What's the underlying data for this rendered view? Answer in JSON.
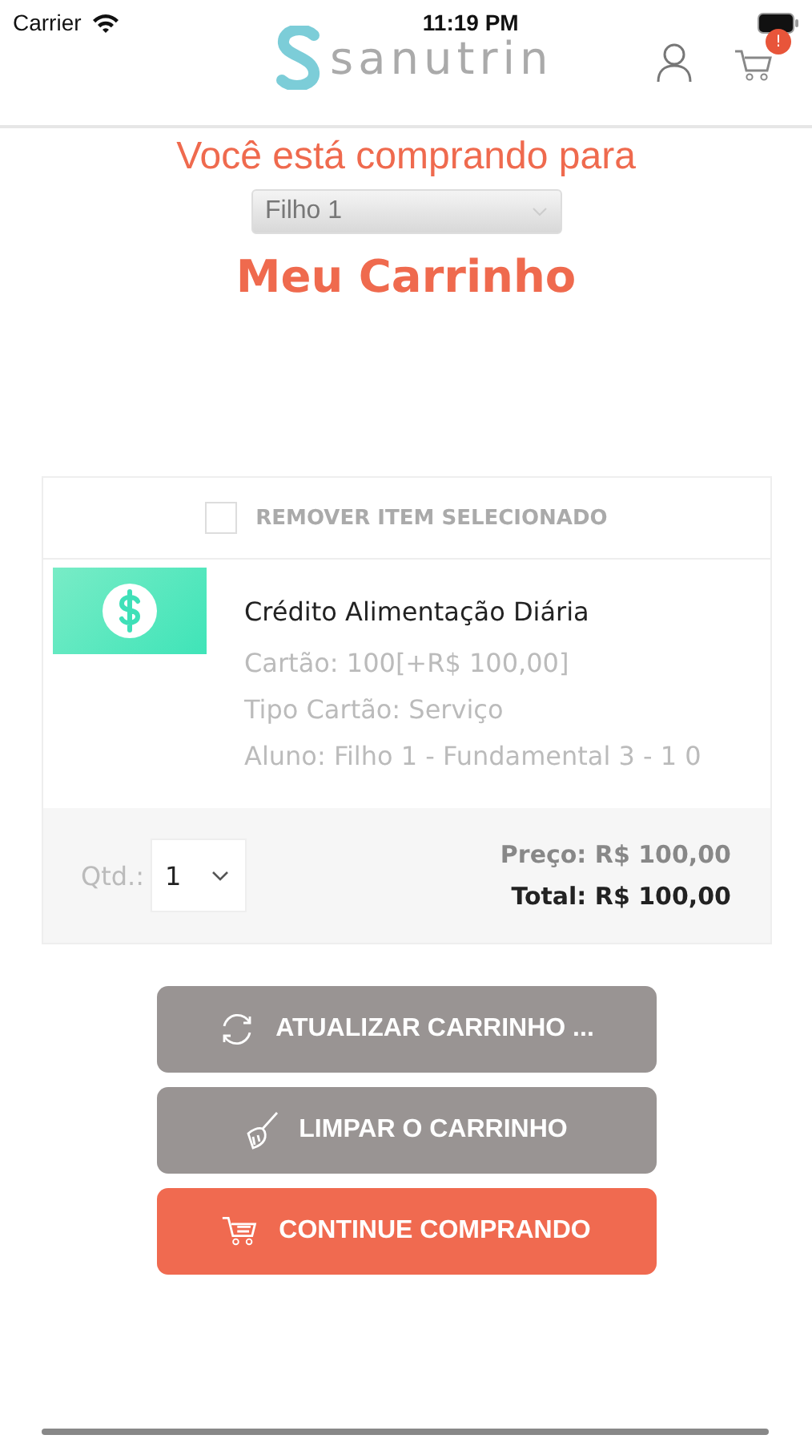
{
  "status_bar": {
    "carrier": "Carrier",
    "time": "11:19 PM"
  },
  "header": {
    "logo": "sanutrin",
    "cart_badge": "!"
  },
  "buying_for": {
    "label": "Você está comprando para",
    "select_value": "Filho 1"
  },
  "title": "Meu Carrinho",
  "cart": {
    "remove_selected": {
      "label": "REMOVER ITEM SELECIONADO",
      "checked": false
    },
    "items": [
      {
        "name": "Crédito Alimentação Diária",
        "details": [
          "Cartão: 100[+R$ 100,00]",
          "Tipo Cartão: Serviço",
          "Aluno: Filho 1 - Fundamental 3 - 1 0"
        ],
        "qty_label": "Qtd.:",
        "qty": "1",
        "price": "Preço: R$ 100,00",
        "total": "Total: R$ 100,00"
      }
    ]
  },
  "buttons": [
    {
      "kind": "refresh",
      "label": "ATUALIZAR CARRINHO ..."
    },
    {
      "kind": "clear",
      "label": "LIMPAR O CARRINHO"
    },
    {
      "kind": "continue",
      "label": "CONTINUE COMPRANDO"
    }
  ]
}
